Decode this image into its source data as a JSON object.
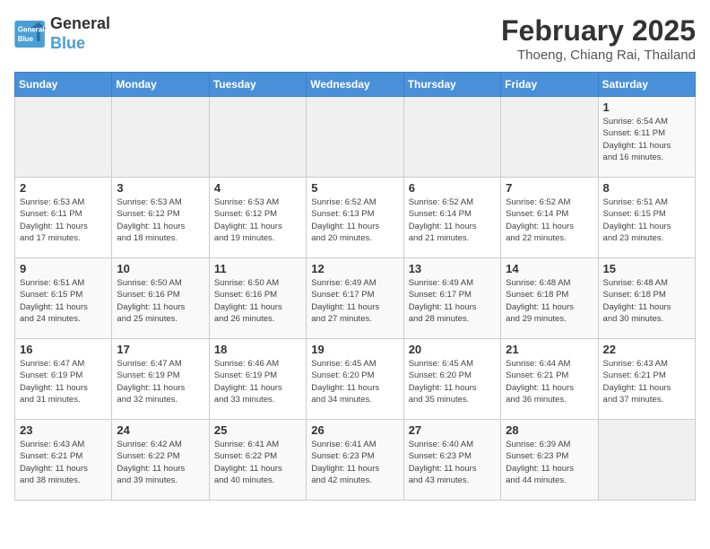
{
  "header": {
    "logo_line1": "General",
    "logo_line2": "Blue",
    "month": "February 2025",
    "location": "Thoeng, Chiang Rai, Thailand"
  },
  "weekdays": [
    "Sunday",
    "Monday",
    "Tuesday",
    "Wednesday",
    "Thursday",
    "Friday",
    "Saturday"
  ],
  "weeks": [
    [
      {
        "day": "",
        "info": ""
      },
      {
        "day": "",
        "info": ""
      },
      {
        "day": "",
        "info": ""
      },
      {
        "day": "",
        "info": ""
      },
      {
        "day": "",
        "info": ""
      },
      {
        "day": "",
        "info": ""
      },
      {
        "day": "1",
        "info": "Sunrise: 6:54 AM\nSunset: 6:11 PM\nDaylight: 11 hours\nand 16 minutes."
      }
    ],
    [
      {
        "day": "2",
        "info": "Sunrise: 6:53 AM\nSunset: 6:11 PM\nDaylight: 11 hours\nand 17 minutes."
      },
      {
        "day": "3",
        "info": "Sunrise: 6:53 AM\nSunset: 6:12 PM\nDaylight: 11 hours\nand 18 minutes."
      },
      {
        "day": "4",
        "info": "Sunrise: 6:53 AM\nSunset: 6:12 PM\nDaylight: 11 hours\nand 19 minutes."
      },
      {
        "day": "5",
        "info": "Sunrise: 6:52 AM\nSunset: 6:13 PM\nDaylight: 11 hours\nand 20 minutes."
      },
      {
        "day": "6",
        "info": "Sunrise: 6:52 AM\nSunset: 6:14 PM\nDaylight: 11 hours\nand 21 minutes."
      },
      {
        "day": "7",
        "info": "Sunrise: 6:52 AM\nSunset: 6:14 PM\nDaylight: 11 hours\nand 22 minutes."
      },
      {
        "day": "8",
        "info": "Sunrise: 6:51 AM\nSunset: 6:15 PM\nDaylight: 11 hours\nand 23 minutes."
      }
    ],
    [
      {
        "day": "9",
        "info": "Sunrise: 6:51 AM\nSunset: 6:15 PM\nDaylight: 11 hours\nand 24 minutes."
      },
      {
        "day": "10",
        "info": "Sunrise: 6:50 AM\nSunset: 6:16 PM\nDaylight: 11 hours\nand 25 minutes."
      },
      {
        "day": "11",
        "info": "Sunrise: 6:50 AM\nSunset: 6:16 PM\nDaylight: 11 hours\nand 26 minutes."
      },
      {
        "day": "12",
        "info": "Sunrise: 6:49 AM\nSunset: 6:17 PM\nDaylight: 11 hours\nand 27 minutes."
      },
      {
        "day": "13",
        "info": "Sunrise: 6:49 AM\nSunset: 6:17 PM\nDaylight: 11 hours\nand 28 minutes."
      },
      {
        "day": "14",
        "info": "Sunrise: 6:48 AM\nSunset: 6:18 PM\nDaylight: 11 hours\nand 29 minutes."
      },
      {
        "day": "15",
        "info": "Sunrise: 6:48 AM\nSunset: 6:18 PM\nDaylight: 11 hours\nand 30 minutes."
      }
    ],
    [
      {
        "day": "16",
        "info": "Sunrise: 6:47 AM\nSunset: 6:19 PM\nDaylight: 11 hours\nand 31 minutes."
      },
      {
        "day": "17",
        "info": "Sunrise: 6:47 AM\nSunset: 6:19 PM\nDaylight: 11 hours\nand 32 minutes."
      },
      {
        "day": "18",
        "info": "Sunrise: 6:46 AM\nSunset: 6:19 PM\nDaylight: 11 hours\nand 33 minutes."
      },
      {
        "day": "19",
        "info": "Sunrise: 6:45 AM\nSunset: 6:20 PM\nDaylight: 11 hours\nand 34 minutes."
      },
      {
        "day": "20",
        "info": "Sunrise: 6:45 AM\nSunset: 6:20 PM\nDaylight: 11 hours\nand 35 minutes."
      },
      {
        "day": "21",
        "info": "Sunrise: 6:44 AM\nSunset: 6:21 PM\nDaylight: 11 hours\nand 36 minutes."
      },
      {
        "day": "22",
        "info": "Sunrise: 6:43 AM\nSunset: 6:21 PM\nDaylight: 11 hours\nand 37 minutes."
      }
    ],
    [
      {
        "day": "23",
        "info": "Sunrise: 6:43 AM\nSunset: 6:21 PM\nDaylight: 11 hours\nand 38 minutes."
      },
      {
        "day": "24",
        "info": "Sunrise: 6:42 AM\nSunset: 6:22 PM\nDaylight: 11 hours\nand 39 minutes."
      },
      {
        "day": "25",
        "info": "Sunrise: 6:41 AM\nSunset: 6:22 PM\nDaylight: 11 hours\nand 40 minutes."
      },
      {
        "day": "26",
        "info": "Sunrise: 6:41 AM\nSunset: 6:23 PM\nDaylight: 11 hours\nand 42 minutes."
      },
      {
        "day": "27",
        "info": "Sunrise: 6:40 AM\nSunset: 6:23 PM\nDaylight: 11 hours\nand 43 minutes."
      },
      {
        "day": "28",
        "info": "Sunrise: 6:39 AM\nSunset: 6:23 PM\nDaylight: 11 hours\nand 44 minutes."
      },
      {
        "day": "",
        "info": ""
      }
    ]
  ]
}
